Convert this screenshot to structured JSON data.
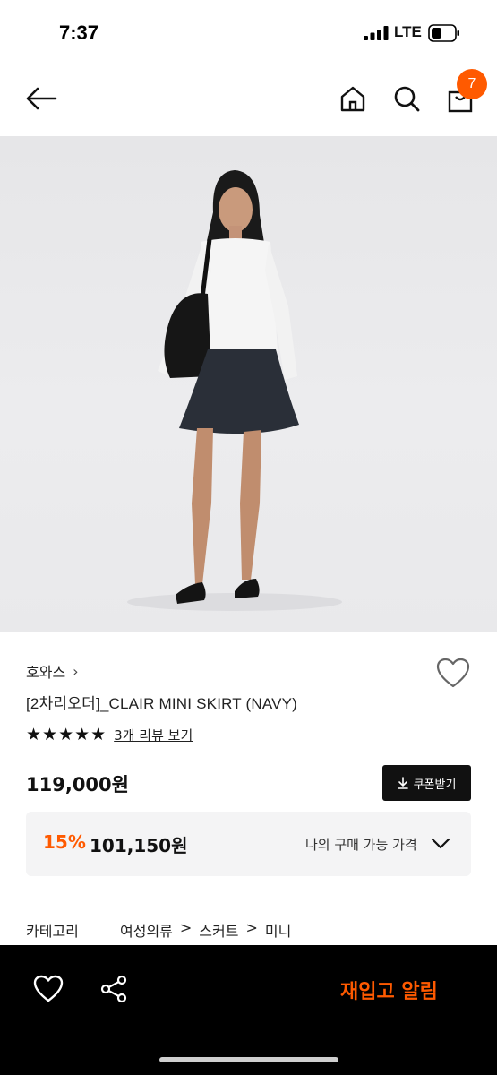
{
  "status": {
    "time": "7:37",
    "network": "LTE"
  },
  "nav": {
    "cart_count": "7"
  },
  "product": {
    "brand": "호와스",
    "name": "[2차리오더]_CLAIR MINI SKIRT (NAVY)",
    "rating": {
      "stars": "★★★★★",
      "review_link": "3개 리뷰 보기"
    },
    "price": "119,000원",
    "coupon_label": "쿠폰받기",
    "discount": {
      "rate": "15%",
      "price": "101,150원",
      "label": "나의 구매 가능 가격"
    },
    "category": {
      "label": "카테고리",
      "path": [
        "여성의류",
        "스커트",
        "미니"
      ],
      "separator": ">"
    }
  },
  "bottom_bar": {
    "restock_label": "재입고 알림"
  },
  "colors": {
    "accent": "#ff5a00",
    "dark": "#111111",
    "panel": "#f4f4f5"
  }
}
